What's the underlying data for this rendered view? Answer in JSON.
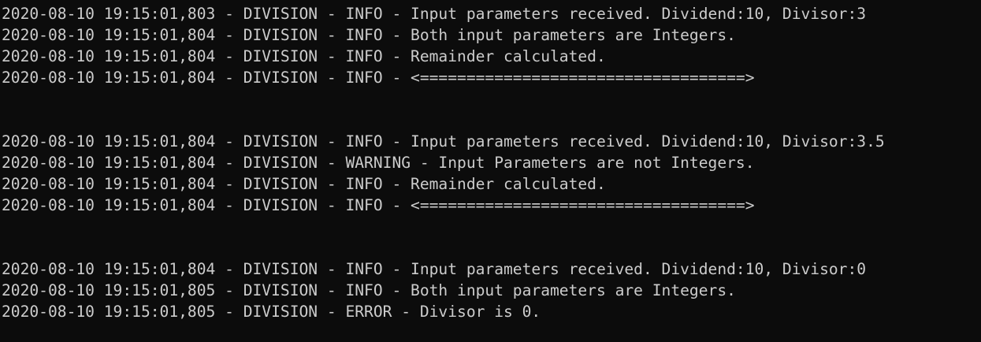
{
  "console": {
    "lines": [
      {
        "text": "2020-08-10 19:15:01,803 - DIVISION - INFO - Input parameters received. Dividend:10, Divisor:3"
      },
      {
        "text": "2020-08-10 19:15:01,804 - DIVISION - INFO - Both input parameters are Integers."
      },
      {
        "text": "2020-08-10 19:15:01,804 - DIVISION - INFO - Remainder calculated."
      },
      {
        "text": "2020-08-10 19:15:01,804 - DIVISION - INFO - <===================================>"
      },
      {
        "text": ""
      },
      {
        "text": ""
      },
      {
        "text": "2020-08-10 19:15:01,804 - DIVISION - INFO - Input parameters received. Dividend:10, Divisor:3.5"
      },
      {
        "text": "2020-08-10 19:15:01,804 - DIVISION - WARNING - Input Parameters are not Integers."
      },
      {
        "text": "2020-08-10 19:15:01,804 - DIVISION - INFO - Remainder calculated."
      },
      {
        "text": "2020-08-10 19:15:01,804 - DIVISION - INFO - <===================================>"
      },
      {
        "text": ""
      },
      {
        "text": ""
      },
      {
        "text": "2020-08-10 19:15:01,804 - DIVISION - INFO - Input parameters received. Dividend:10, Divisor:0"
      },
      {
        "text": "2020-08-10 19:15:01,805 - DIVISION - INFO - Both input parameters are Integers."
      },
      {
        "text": "2020-08-10 19:15:01,805 - DIVISION - ERROR - Divisor is 0."
      }
    ]
  },
  "colors": {
    "background": "#0c0c0c",
    "text": "#cccccc"
  }
}
